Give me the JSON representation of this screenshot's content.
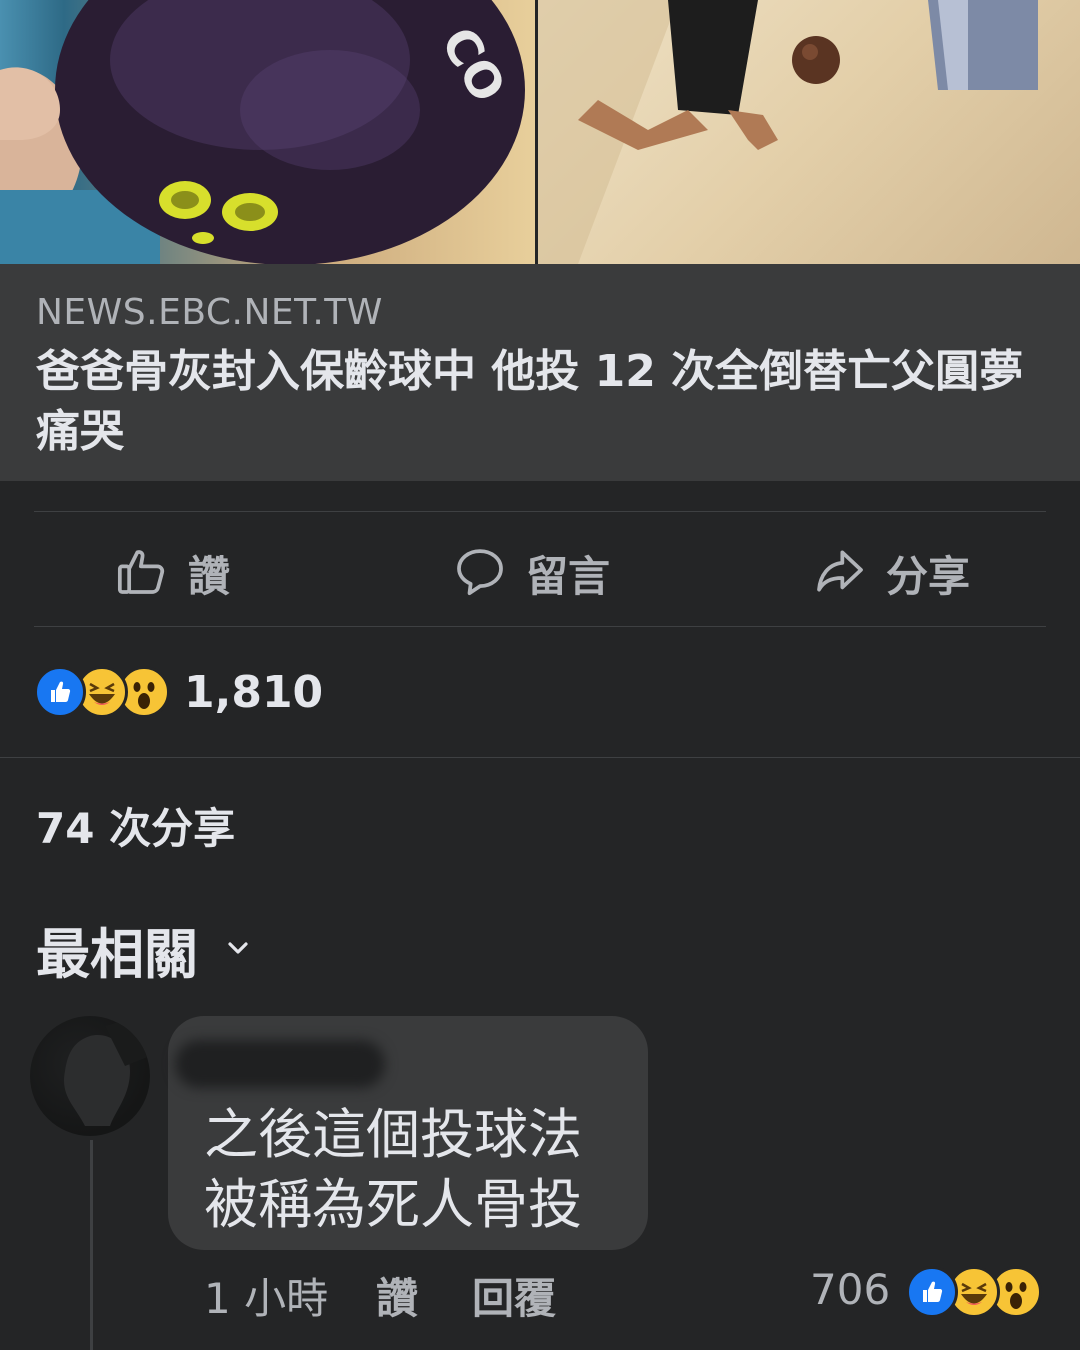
{
  "link_preview": {
    "domain": "NEWS.EBC.NET.TW",
    "headline": "爸爸骨灰封入保齡球中 他投 12 次全倒替亡父圓夢痛哭"
  },
  "actions": {
    "like": "讚",
    "comment": "留言",
    "share": "分享"
  },
  "reactions": {
    "icons": [
      "like-reaction",
      "haha-reaction",
      "wow-reaction"
    ],
    "count": "1,810"
  },
  "shares": "74 次分享",
  "sort": {
    "label": "最相關"
  },
  "comment": {
    "text_line1": "之後這個投球法",
    "text_line2": "被稱為死人骨投",
    "time": "1 小時",
    "like": "讚",
    "reply": "回覆",
    "reaction_count": "706",
    "reaction_icons": [
      "like-reaction",
      "haha-reaction",
      "wow-reaction"
    ]
  },
  "colors": {
    "background": "#242526",
    "card": "#3a3b3c",
    "primary_text": "#e4e6eb",
    "secondary_text": "#b0b3b8",
    "like_blue": "#1877f2",
    "emoji_yellow": "#f7c436"
  }
}
